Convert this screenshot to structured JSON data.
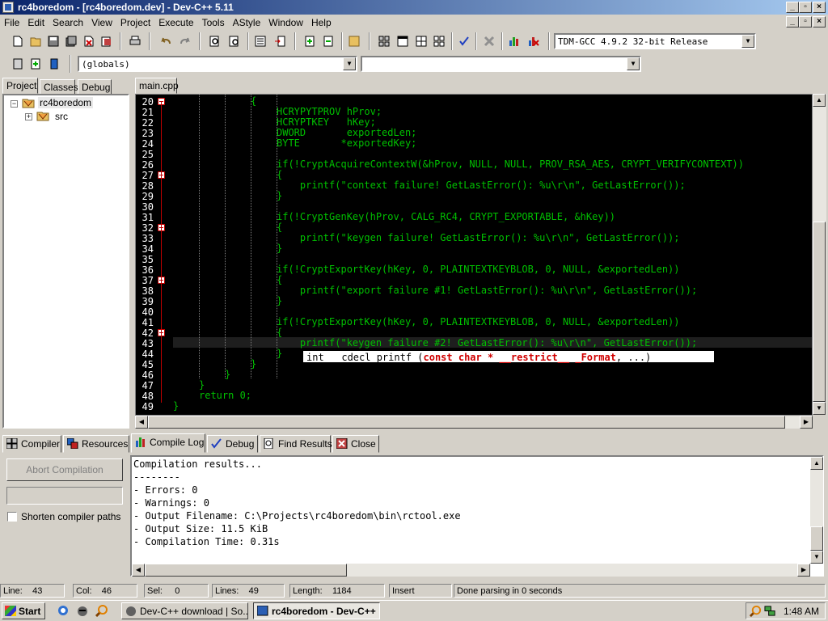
{
  "window": {
    "title": "rc4boredom - [rc4boredom.dev] - Dev-C++ 5.11"
  },
  "menu": [
    "File",
    "Edit",
    "Search",
    "View",
    "Project",
    "Execute",
    "Tools",
    "AStyle",
    "Window",
    "Help"
  ],
  "toolbar": {
    "compiler_select": "TDM-GCC 4.9.2 32-bit Release",
    "scope_select": "(globals)",
    "function_select": ""
  },
  "left_tabs": [
    "Project",
    "Classes",
    "Debug"
  ],
  "project_tree": {
    "root": "rc4boredom",
    "child": "src"
  },
  "editor": {
    "file_tab": "main.cpp",
    "lines": [
      {
        "n": "20",
        "text": "{"
      },
      {
        "n": "21",
        "text": "HCRYPYTPROV hProv;"
      },
      {
        "n": "22",
        "text": "HCRYPTKEY   hKey;"
      },
      {
        "n": "23",
        "text": "DWORD       exportedLen;"
      },
      {
        "n": "24",
        "text": "BYTE       *exportedKey;"
      },
      {
        "n": "25",
        "text": ""
      },
      {
        "n": "26",
        "text": "if(!CryptAcquireContextW(&hProv, NULL, NULL, PROV_RSA_AES, CRYPT_VERIFYCONTEXT))"
      },
      {
        "n": "27",
        "text": "{"
      },
      {
        "n": "28",
        "text": "    printf(\"context failure! GetLastError(): %u\\r\\n\", GetLastError());"
      },
      {
        "n": "29",
        "text": "}"
      },
      {
        "n": "30",
        "text": ""
      },
      {
        "n": "31",
        "text": "if(!CryptGenKey(hProv, CALG_RC4, CRYPT_EXPORTABLE, &hKey))"
      },
      {
        "n": "32",
        "text": "{"
      },
      {
        "n": "33",
        "text": "    printf(\"keygen failure! GetLastError(): %u\\r\\n\", GetLastError());"
      },
      {
        "n": "34",
        "text": "}"
      },
      {
        "n": "35",
        "text": ""
      },
      {
        "n": "36",
        "text": "if(!CryptExportKey(hKey, 0, PLAINTEXTKEYBLOB, 0, NULL, &exportedLen))"
      },
      {
        "n": "37",
        "text": "{"
      },
      {
        "n": "38",
        "text": "    printf(\"export failure #1! GetLastError(): %u\\r\\n\", GetLastError());"
      },
      {
        "n": "39",
        "text": "}"
      },
      {
        "n": "40",
        "text": ""
      },
      {
        "n": "41",
        "text": "if(!CryptExportKey(hKey, 0, PLAINTEXTKEYBLOB, 0, NULL, &exportedLen))"
      },
      {
        "n": "42",
        "text": "{"
      },
      {
        "n": "43",
        "text": "    printf(\"keygen failure #2! GetLastError(): %u\\r\\n\", GetLastError());"
      },
      {
        "n": "44",
        "text": "}"
      },
      {
        "n": "45",
        "text": "}"
      },
      {
        "n": "46",
        "text": "}"
      },
      {
        "n": "47",
        "text": "}"
      },
      {
        "n": "48",
        "text": "return 0;"
      },
      {
        "n": "49",
        "text": "}"
      }
    ],
    "tooltip": {
      "prefix": "int __cdecl printf (",
      "highlight": "const char * __restrict__ _Format",
      "suffix": ", ...)"
    }
  },
  "bottom_tabs": [
    "Compiler",
    "Resources",
    "Compile Log",
    "Debug",
    "Find Results",
    "Close"
  ],
  "compile": {
    "abort_label": "Abort Compilation",
    "shorten_label": "Shorten compiler paths",
    "log": [
      "Compilation results...",
      "--------",
      "- Errors: 0",
      "- Warnings: 0",
      "- Output Filename: C:\\Projects\\rc4boredom\\bin\\rctool.exe",
      "- Output Size: 11.5 KiB",
      "- Compilation Time: 0.31s"
    ]
  },
  "status": {
    "line_label": "Line:",
    "line": "43",
    "col_label": "Col:",
    "col": "46",
    "sel_label": "Sel:",
    "sel": "0",
    "lines_label": "Lines:",
    "lines": "49",
    "length_label": "Length:",
    "length": "1184",
    "mode": "Insert",
    "message": "Done parsing in 0 seconds"
  },
  "taskbar": {
    "start": "Start",
    "tasks": [
      "Dev-C++ download | So...",
      "rc4boredom - Dev-C++"
    ],
    "clock": "1:48 AM"
  },
  "colors": {
    "titlebar": "#0a246a",
    "editor_bg": "#000000",
    "code": "#00c000",
    "fold": "#c00000"
  }
}
